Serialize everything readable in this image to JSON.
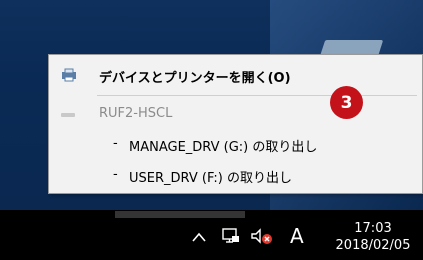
{
  "context_menu": {
    "open_devices_label": "デバイスとプリンターを開く(O)",
    "device_name": "RUF2-HSCL",
    "eject_items": [
      {
        "bullet": "-",
        "label": "MANAGE_DRV (G:) の取り出し"
      },
      {
        "bullet": "-",
        "label": "USER_DRV (F:) の取り出し"
      }
    ]
  },
  "annotation": {
    "badge_number": "3",
    "badge_color": "#c4121a"
  },
  "taskbar": {
    "chevron": "^",
    "ime_indicator": "A",
    "clock_time": "17:03",
    "clock_date": "2018/02/05",
    "icons": [
      "chevron-up-icon",
      "network-icon",
      "volume-muted-icon"
    ]
  }
}
